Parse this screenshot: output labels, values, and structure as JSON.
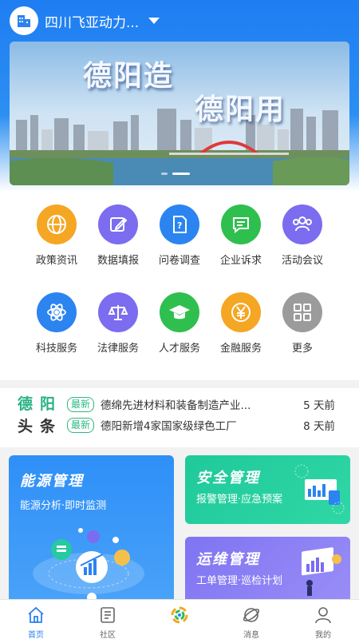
{
  "header": {
    "company_name": "四川飞亚动力...",
    "logo_icon": "building-icon",
    "dropdown_icon": "caret-down-icon"
  },
  "banner": {
    "headline_1": "德阳造",
    "headline_2": "德阳用",
    "slide_count": 2,
    "active_slide": 2
  },
  "services": [
    {
      "label": "政策资讯",
      "icon": "globe-icon",
      "color": "#f5a623"
    },
    {
      "label": "数据填报",
      "icon": "edit-icon",
      "color": "#7b6cf0"
    },
    {
      "label": "问卷调查",
      "icon": "question-doc-icon",
      "color": "#2b84f0"
    },
    {
      "label": "企业诉求",
      "icon": "message-icon",
      "color": "#2fbf4f"
    },
    {
      "label": "活动会议",
      "icon": "people-icon",
      "color": "#7b6cf0"
    },
    {
      "label": "科技服务",
      "icon": "atom-icon",
      "color": "#2b84f0"
    },
    {
      "label": "法律服务",
      "icon": "scale-icon",
      "color": "#7b6cf0"
    },
    {
      "label": "人才服务",
      "icon": "graduation-cap-icon",
      "color": "#2fbf4f"
    },
    {
      "label": "金融服务",
      "icon": "yen-icon",
      "color": "#f5a623"
    },
    {
      "label": "更多",
      "icon": "grid-icon",
      "color": "#9b9b9b"
    }
  ],
  "news": {
    "brand_line1": "德阳",
    "brand_line2": "头条",
    "items": [
      {
        "tag": "最新",
        "title": "德绵先进材料和装备制造产业...",
        "time": "5 天前"
      },
      {
        "tag": "最新",
        "title": "德阳新增4家国家级绿色工厂",
        "time": "8 天前"
      }
    ]
  },
  "cards": {
    "energy": {
      "title": "能源管理",
      "subtitle": "能源分析·即时监测"
    },
    "safety": {
      "title": "安全管理",
      "subtitle": "报警管理·应急预案"
    },
    "ops": {
      "title": "运维管理",
      "subtitle": "工单管理·巡检计划"
    }
  },
  "tabbar": [
    {
      "label": "首页",
      "icon": "home-icon",
      "active": true
    },
    {
      "label": "社区",
      "icon": "community-icon",
      "active": false
    },
    {
      "label": "",
      "icon": "app-logo-icon",
      "active": false
    },
    {
      "label": "消息",
      "icon": "message-planet-icon",
      "active": false
    },
    {
      "label": "我的",
      "icon": "user-icon",
      "active": false
    }
  ],
  "colors": {
    "primary": "#2b82f0",
    "news_green": "#2fb784",
    "energy_card": "#2e8ff7",
    "safety_card": "#1fc99a",
    "ops_card": "#8a7ef4"
  }
}
